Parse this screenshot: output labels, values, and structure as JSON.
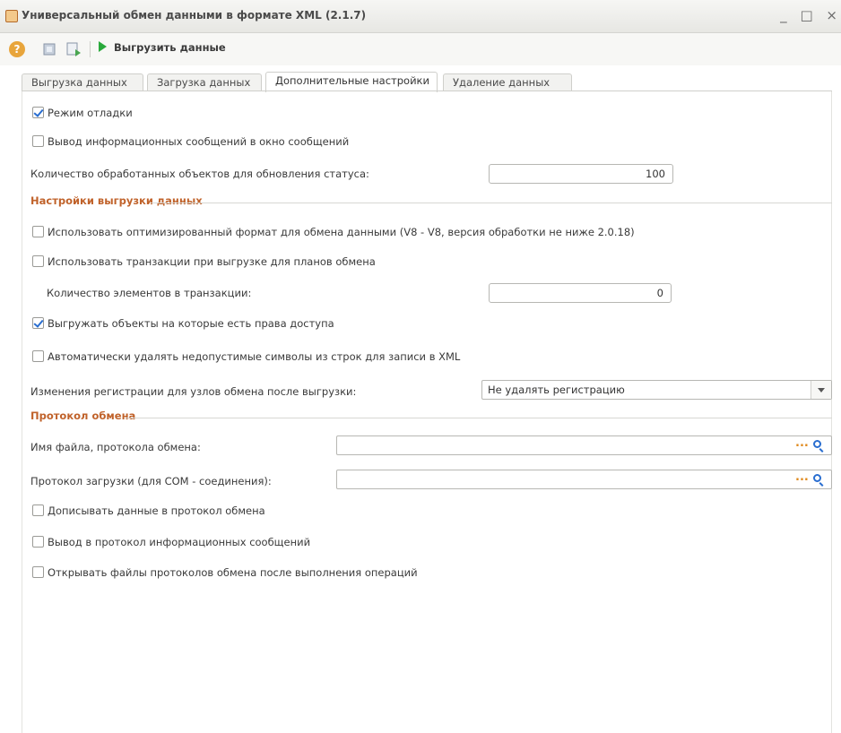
{
  "window": {
    "title": "Универсальный обмен данными в формате XML (2.1.7)",
    "controls": [
      "_",
      "□",
      "×"
    ]
  },
  "toolbar": {
    "help_label": "?",
    "run_label": "Выгрузить данные"
  },
  "tabs": [
    {
      "label": "Выгрузка данных",
      "active": false
    },
    {
      "label": "Загрузка данных",
      "active": false
    },
    {
      "label": "Дополнительные настройки",
      "active": true
    },
    {
      "label": "Удаление данных",
      "active": false
    }
  ],
  "settings": {
    "debug_mode": {
      "label": "Режим отладки",
      "checked": true
    },
    "info_messages": {
      "label": "Вывод информационных сообщений в окно сообщений",
      "checked": false
    },
    "objects_count": {
      "label": "Количество обработанных объектов для обновления статуса:",
      "value": "100"
    }
  },
  "export_section": {
    "title": "Настройки выгрузки данных",
    "optimized_format": {
      "label": "Использовать оптимизированный формат для обмена данными (V8 - V8, версия обработки не ниже 2.0.18)",
      "checked": false
    },
    "use_transactions": {
      "label": "Использовать транзакции при выгрузке для планов обмена",
      "checked": false
    },
    "transaction_items": {
      "label": "Количество элементов в транзакции:",
      "value": "0"
    },
    "access_rights": {
      "label": "Выгружать объекты на которые есть права доступа",
      "checked": true
    },
    "remove_invalid": {
      "label": "Автоматически удалять недопустимые символы из строк для записи в XML",
      "checked": false
    },
    "registration": {
      "label": "Изменения регистрации для узлов обмена после выгрузки:",
      "value": "Не удалять регистрацию"
    }
  },
  "protocol_section": {
    "title": "Протокол обмена",
    "file_name": {
      "label": "Имя файла, протокола обмена:",
      "value": ""
    },
    "load_protocol": {
      "label": "Протокол загрузки (для COM - соединения):",
      "value": ""
    },
    "append_data": {
      "label": "Дописывать данные в протокол обмена",
      "checked": false
    },
    "info_to_protocol": {
      "label": "Вывод в протокол информационных сообщений",
      "checked": false
    },
    "open_files": {
      "label": "Открывать файлы протоколов обмена после выполнения операций",
      "checked": false
    }
  },
  "colors": {
    "section_title": "#c0622a",
    "run_icon": "#29a93b",
    "accent": "#2a6ed0"
  }
}
